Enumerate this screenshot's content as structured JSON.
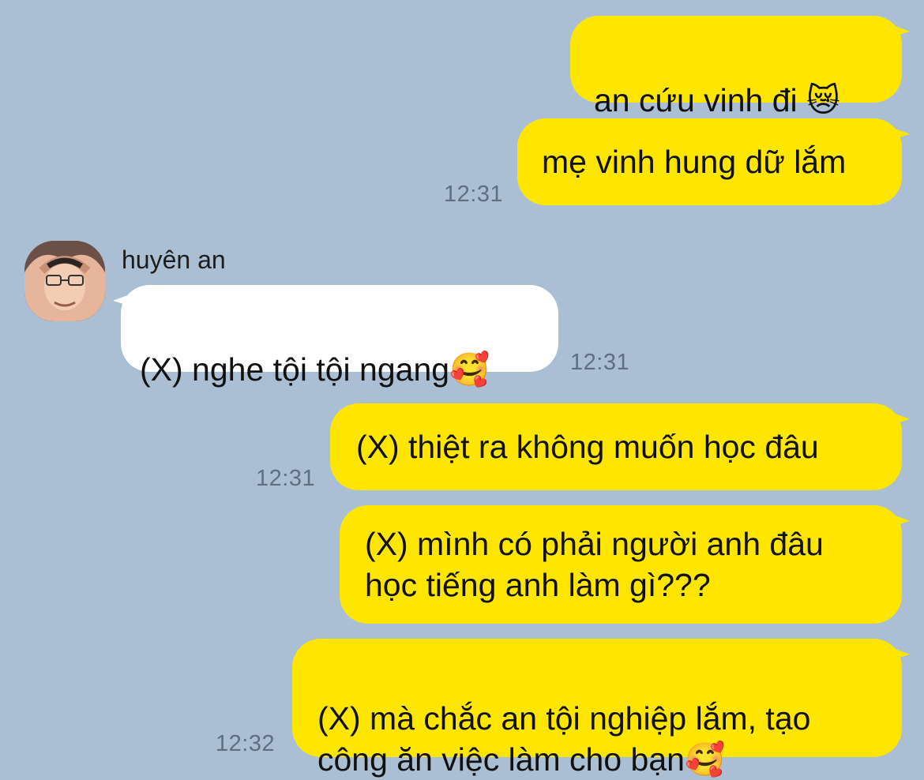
{
  "conversation": {
    "messages": [
      {
        "direction": "outgoing",
        "text": "an cứu vinh đi ",
        "emoji": "😿"
      },
      {
        "direction": "outgoing",
        "text": "mẹ vinh hung dữ lắm",
        "time": "12:31"
      },
      {
        "direction": "incoming",
        "sender": "huyên an",
        "text": "(X) nghe tội tội ngang",
        "emoji": "🥰",
        "time": "12:31"
      },
      {
        "direction": "outgoing",
        "text": "(X) thiệt ra không muốn học đâu",
        "time": "12:31"
      },
      {
        "direction": "outgoing",
        "text": "(X) mình có phải người anh đâu\nhọc tiếng anh làm gì???"
      },
      {
        "direction": "outgoing",
        "text": "(X) mà chắc an tội nghiệp lắm, tạo\ncông ăn việc làm cho bạn",
        "emoji": "🥰",
        "time": "12:32"
      }
    ]
  },
  "colors": {
    "background": "#abbfd4",
    "outgoing_bubble": "#ffe600",
    "incoming_bubble": "#ffffff",
    "timestamp": "#5f6f80"
  },
  "icons": {
    "avatar": "profile-photo"
  }
}
